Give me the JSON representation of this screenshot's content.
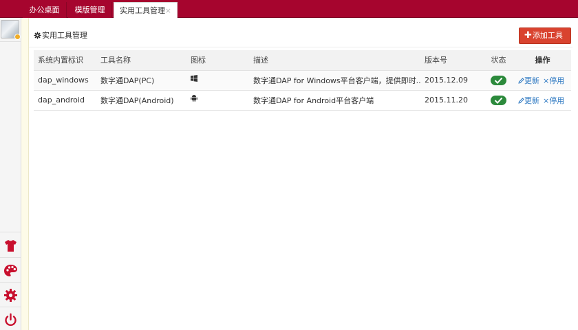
{
  "tabs": [
    {
      "label": "办公桌面"
    },
    {
      "label": "模版管理"
    },
    {
      "label": "实用工具管理",
      "close": "×"
    }
  ],
  "sidebar": {
    "icons": [
      "tshirt-icon",
      "palette-icon",
      "gear-icon",
      "power-icon"
    ],
    "accent": "#c8102e"
  },
  "panel": {
    "title": "实用工具管理",
    "add_button": "添加工具"
  },
  "table": {
    "headers": [
      "系统内置标识",
      "工具名称",
      "图标",
      "描述",
      "版本号",
      "状态",
      "操作"
    ],
    "rows": [
      {
        "id": "dap_windows",
        "name": "数字通DAP(PC)",
        "icon": "windows-icon",
        "description": "数字通DAP for Windows平台客户端，提供即时...",
        "version": "2015.12.09",
        "status": "enabled",
        "edit": "更新",
        "disable": "停用"
      },
      {
        "id": "dap_android",
        "name": "数字通DAP(Android)",
        "icon": "android-icon",
        "description": "数字通DAP for Android平台客户端",
        "version": "2015.11.20",
        "status": "enabled",
        "edit": "更新",
        "disable": "停用"
      }
    ]
  },
  "colors": {
    "topbar": "#a6052e",
    "add_button": "#d9432f",
    "status_on": "#2c8a3c",
    "link": "#2e79c2"
  }
}
